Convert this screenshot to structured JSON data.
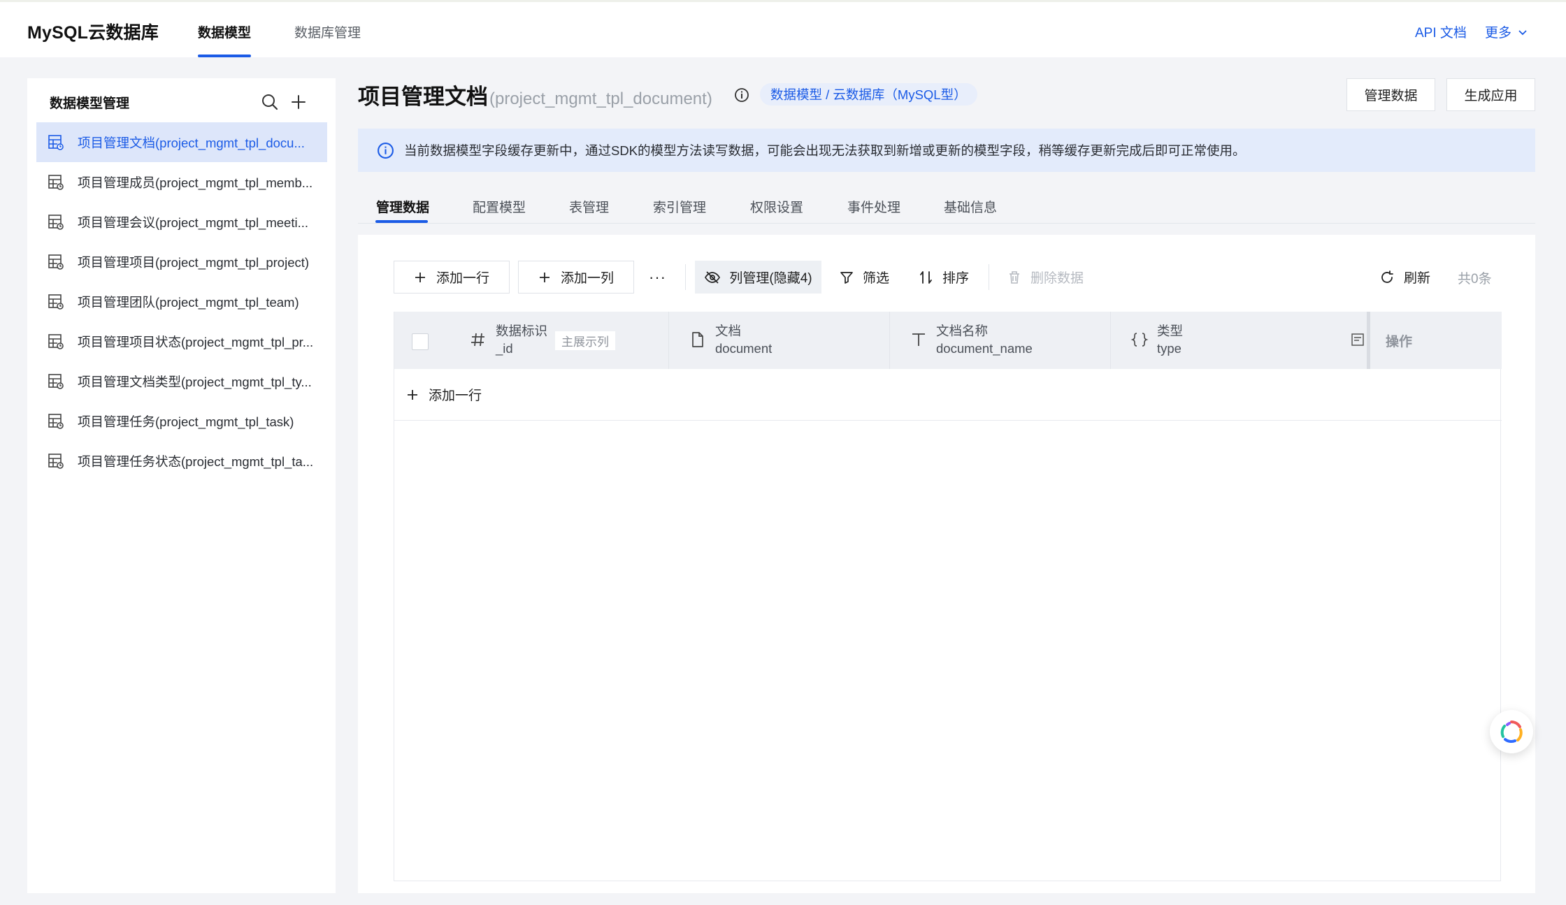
{
  "topbar": {
    "brand": "MySQL云数据库",
    "nav": [
      {
        "label": "数据模型",
        "active": true
      },
      {
        "label": "数据库管理",
        "active": false
      }
    ],
    "api_doc": "API 文档",
    "more": "更多"
  },
  "sidebar": {
    "title": "数据模型管理",
    "items": [
      {
        "label": "项目管理文档(project_mgmt_tpl_docu..."
      },
      {
        "label": "项目管理成员(project_mgmt_tpl_memb..."
      },
      {
        "label": "项目管理会议(project_mgmt_tpl_meeti..."
      },
      {
        "label": "项目管理项目(project_mgmt_tpl_project)"
      },
      {
        "label": "项目管理团队(project_mgmt_tpl_team)"
      },
      {
        "label": "项目管理项目状态(project_mgmt_tpl_pr..."
      },
      {
        "label": "项目管理文档类型(project_mgmt_tpl_ty..."
      },
      {
        "label": "项目管理任务(project_mgmt_tpl_task)"
      },
      {
        "label": "项目管理任务状态(project_mgmt_tpl_ta..."
      }
    ]
  },
  "header": {
    "title": "项目管理文档",
    "subtitle": "(project_mgmt_tpl_document)",
    "breadcrumb": "数据模型 / 云数据库（MySQL型）",
    "manage_data": "管理数据",
    "generate_app": "生成应用"
  },
  "notice": {
    "text": "当前数据模型字段缓存更新中，通过SDK的模型方法读写数据，可能会出现无法获取到新增或更新的模型字段，稍等缓存更新完成后即可正常使用。"
  },
  "tabs": [
    "管理数据",
    "配置模型",
    "表管理",
    "索引管理",
    "权限设置",
    "事件处理",
    "基础信息"
  ],
  "toolbar": {
    "add_row": "添加一行",
    "add_col": "添加一列",
    "more": "···",
    "columns": "列管理(隐藏4)",
    "filter": "筛选",
    "sort": "排序",
    "delete": "删除数据",
    "refresh": "刷新",
    "count": "共0条"
  },
  "table": {
    "columns": [
      {
        "icon": "hash-icon",
        "label": "数据标识",
        "field": "_id",
        "tag": "主展示列"
      },
      {
        "icon": "file-icon",
        "label": "文档",
        "field": "document"
      },
      {
        "icon": "text-type-icon",
        "label": "文档名称",
        "field": "document_name"
      },
      {
        "icon": "braces-icon",
        "label": "类型",
        "field": "type"
      }
    ],
    "actions_header": "操作",
    "add_row": "添加一行"
  },
  "colors": {
    "accent": "#1b5be6",
    "notice_bg": "#e3ebfb",
    "active_item_bg": "#dde6fa"
  }
}
